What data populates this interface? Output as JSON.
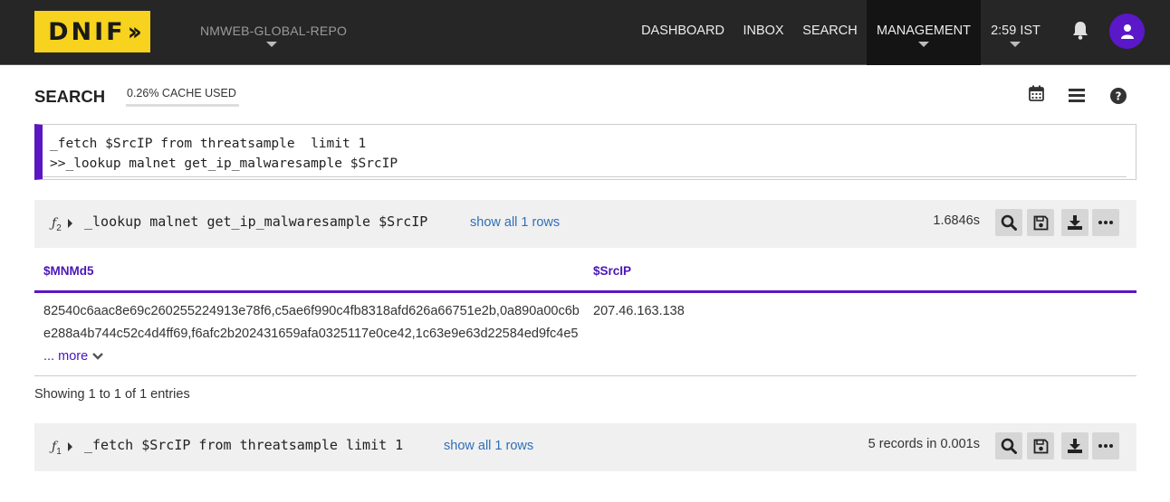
{
  "nav": {
    "logo_text": "DNIF",
    "repo": "NMWEB-GLOBAL-REPO",
    "items": [
      "DASHBOARD",
      "INBOX",
      "SEARCH",
      "MANAGEMENT"
    ],
    "time": "2:59 IST"
  },
  "search": {
    "title": "SEARCH",
    "cache": "0.26% CACHE USED",
    "query_line1": "_fetch $SrcIP from threatsample  limit 1",
    "query_line2": ">>_lookup malnet get_ip_malwaresample $SrcIP"
  },
  "step2": {
    "fx": "ƒ",
    "index": "2",
    "command": "_lookup malnet get_ip_malwaresample $SrcIP",
    "show_all": "show all 1 rows",
    "time": "1.6846s"
  },
  "table": {
    "columns": [
      "$MNMd5",
      "$SrcIP"
    ],
    "rows": [
      {
        "md5": "82540c6aac8e69c260255224913e78f6,c5ae6f990c4fb8318afd626a66751e2b,0a890a00c6be288a4b744c52c4d4ff69,f6afc2b202431659afa0325117e0ce42,1c63e9e63d22584ed9fc4e5",
        "more": "... more",
        "srcip": "207.46.163.138"
      }
    ],
    "showing": "Showing 1 to 1 of 1 entries"
  },
  "step1": {
    "fx": "ƒ",
    "index": "1",
    "command": "_fetch $SrcIP from threatsample limit 1",
    "show_all": "show all 1 rows",
    "stat": "5 records in 0.001s"
  },
  "colors": {
    "accent_purple": "#5b16c4",
    "logo_yellow": "#f7d21e",
    "topbar": "#262626",
    "link_blue": "#2f6fb8"
  },
  "icons": [
    "bell-icon",
    "user-icon",
    "calendar-icon",
    "menu-icon",
    "help-icon",
    "search-icon",
    "save-icon",
    "download-icon",
    "more-icon",
    "chevron-down-icon"
  ]
}
